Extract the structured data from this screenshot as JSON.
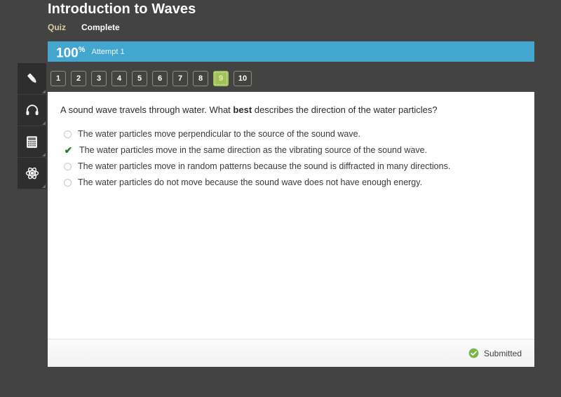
{
  "header": {
    "title": "Introduction to Waves",
    "nav": [
      {
        "label": "Quiz",
        "state": "active"
      },
      {
        "label": "Complete",
        "state": "current"
      }
    ]
  },
  "score": {
    "value": "100",
    "percent_symbol": "%",
    "attempt": "Attempt 1",
    "bar_color": "#43a6cf"
  },
  "toolrail": {
    "items": [
      {
        "icon": "pencil-icon",
        "name": "highlighter-tool"
      },
      {
        "icon": "headphones-icon",
        "name": "audio-tool"
      },
      {
        "icon": "calculator-icon",
        "name": "calculator-tool"
      },
      {
        "icon": "atom-icon",
        "name": "periodic-table-tool"
      }
    ]
  },
  "question_nav": {
    "buttons": [
      "1",
      "2",
      "3",
      "4",
      "5",
      "6",
      "7",
      "8",
      "9",
      "10"
    ],
    "active_index": 8,
    "active_color": "#a3c159"
  },
  "question": {
    "prompt_before": "A sound wave travels through water. What ",
    "prompt_bold": "best",
    "prompt_after": " describes the direction of the water particles?",
    "options": [
      {
        "text": "The water particles move perpendicular to the source of the sound wave.",
        "selected": false
      },
      {
        "text": "The water particles move in the same direction as the vibrating source of the sound wave.",
        "selected": true
      },
      {
        "text": "The water particles move in random patterns because the sound is diffracted in many directions.",
        "selected": false
      },
      {
        "text": "The water particles do not move because the sound wave does not have enough energy.",
        "selected": false
      }
    ],
    "check_glyph": "✔",
    "check_color": "#2b7a34"
  },
  "footer": {
    "status_label": "Submitted",
    "status_icon": "check-circle-icon",
    "status_color": "#7ab648"
  }
}
